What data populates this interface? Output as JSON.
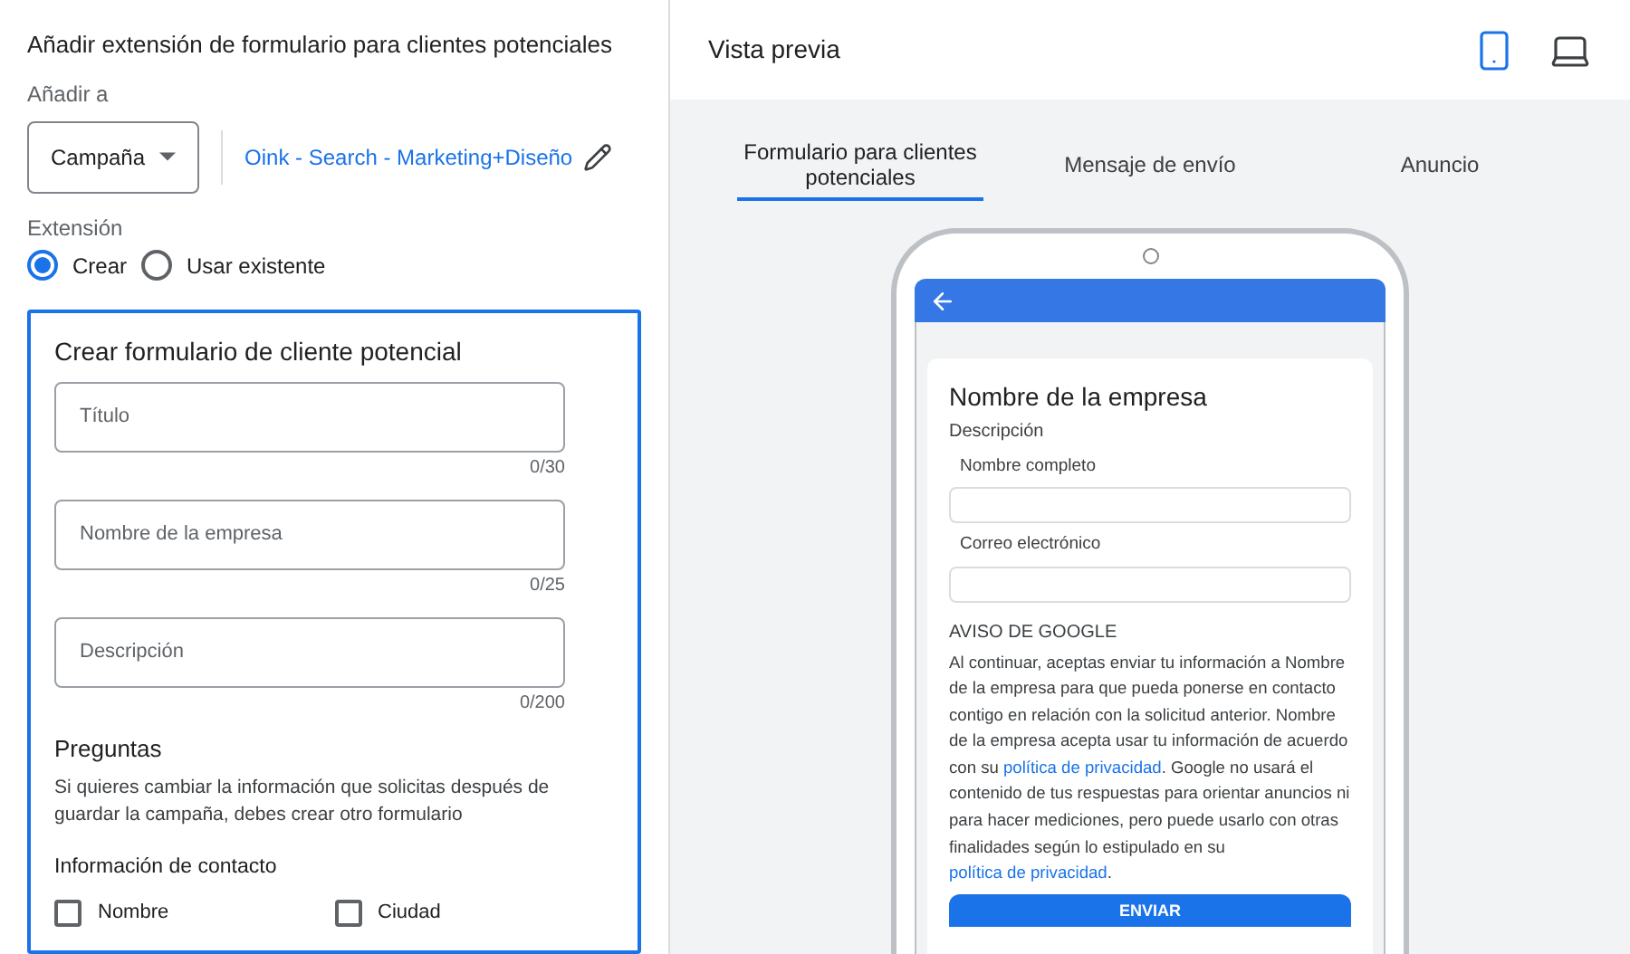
{
  "left": {
    "title": "Añadir extensión de formulario para clientes potenciales",
    "add_to_label": "Añadir a",
    "add_to_select": {
      "value": "Campaña"
    },
    "campaign_link": "Oink - Search - Marketing+Diseño",
    "extension_label": "Extensión",
    "extension_options": [
      {
        "label": "Crear",
        "selected": true
      },
      {
        "label": "Usar existente",
        "selected": false
      }
    ],
    "form": {
      "title": "Crear formulario de cliente potencial",
      "fields": [
        {
          "placeholder": "Título",
          "counter": "0/30"
        },
        {
          "placeholder": "Nombre de la empresa",
          "counter": "0/25"
        },
        {
          "placeholder": "Descripción",
          "counter": "0/200"
        }
      ],
      "questions_title": "Preguntas",
      "questions_note": "Si quieres cambiar la información que solicitas después de guardar la campaña, debes crear otro formulario",
      "contact_title": "Información de contacto",
      "contact_options": [
        {
          "label": "Nombre",
          "checked": false
        },
        {
          "label": "Ciudad",
          "checked": false
        }
      ]
    }
  },
  "preview": {
    "title": "Vista previa",
    "devices": [
      {
        "kind": "phone",
        "selected": true
      },
      {
        "kind": "laptop",
        "selected": false
      }
    ],
    "tabs": [
      {
        "label": "Formulario para clientes potenciales",
        "selected": true
      },
      {
        "label": "Mensaje de envío",
        "selected": false
      },
      {
        "label": "Anuncio",
        "selected": false
      }
    ],
    "phone": {
      "company": "Nombre de la empresa",
      "description": "Descripción",
      "fields": [
        {
          "label": "Nombre completo"
        },
        {
          "label": "Correo electrónico"
        }
      ],
      "notice_title": "AVISO DE GOOGLE",
      "notice": [
        {
          "kind": "text",
          "text": "Al continuar, aceptas enviar tu información a Nombre de la empresa para que pueda ponerse en contacto contigo en relación con la solicitud anterior. Nombre de la empresa acepta usar tu información de acuerdo con su "
        },
        {
          "kind": "link",
          "text": "política de privacidad"
        },
        {
          "kind": "text",
          "text": ". Google no usará el contenido de tus respuestas para orientar anuncios ni para hacer mediciones, pero puede usarlo con otras finalidades según lo estipulado en su "
        },
        {
          "kind": "link",
          "text": "política de privacidad"
        },
        {
          "kind": "text",
          "text": "."
        }
      ],
      "submit": "ENVIAR"
    }
  }
}
